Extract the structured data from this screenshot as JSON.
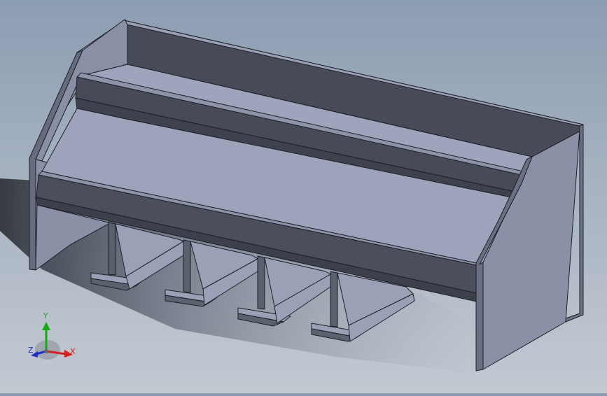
{
  "viewport": {
    "background_top": "#8c9db2",
    "background_bottom": "#c3c9d1",
    "model": "rack-shelf-with-four-brackets",
    "face_colors": {
      "light": "#a2a9c0",
      "mid": "#878ea4",
      "dark": "#474b58",
      "darker": "#3b3f4b",
      "edge": "#1e1f26"
    }
  },
  "triad": {
    "x_label": "X",
    "y_label": "Y",
    "z_label": "Z",
    "x_color": "#d42020",
    "y_color": "#18a818",
    "z_color": "#2030d0"
  }
}
